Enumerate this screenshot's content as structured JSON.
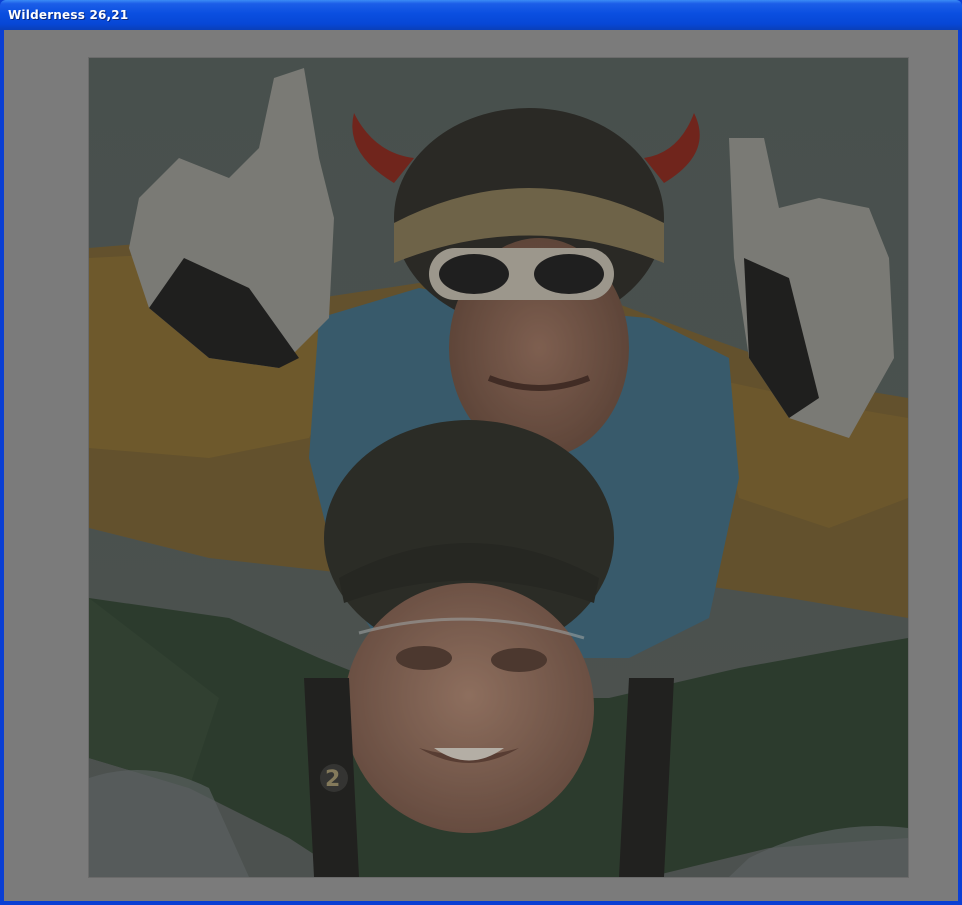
{
  "window": {
    "title": "Wilderness 26,21"
  },
  "image_viewer": {
    "photo_alt": "Tandem skydivers in freefall; rear jumper in helmet with red horns and white sunglasses giving hand signs, front jumper in green suit and leather helmet"
  },
  "colors": {
    "title_bar": "#0a4fe0",
    "client_background": "#7b7b7b",
    "window_frame": "#0a3fd4"
  }
}
